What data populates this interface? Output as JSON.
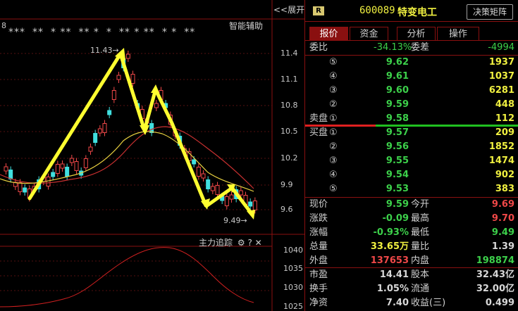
{
  "toolbar": {
    "expand_label": "<<展开",
    "badge": "R",
    "code": "600089",
    "name": "特变电工",
    "decision_button": "决策矩阵"
  },
  "chart": {
    "corner_label": "8",
    "stars": [
      "***",
      "**",
      "* **",
      "** *",
      "*",
      "** * **",
      "* *",
      "**"
    ],
    "assist_label": "智能辅助",
    "high_marker": "11.43",
    "low_marker": "9.49",
    "y_ticks": [
      "11.4",
      "11.1",
      "10.8",
      "10.5",
      "10.2",
      "9.9",
      "9.6"
    ],
    "sub_title": "主力追踪",
    "sub_y_ticks": [
      "1040",
      "1035",
      "1030",
      "1025"
    ]
  },
  "tabs": [
    "报价",
    "资金",
    "分析",
    "操作"
  ],
  "weibi": {
    "label1": "委比",
    "value1": "-34.13%",
    "label2": "委差",
    "value2": "-4994"
  },
  "sell": [
    {
      "label": "",
      "idx": "⑤",
      "price": "9.62",
      "vol": "1937"
    },
    {
      "label": "",
      "idx": "④",
      "price": "9.61",
      "vol": "1037"
    },
    {
      "label": "",
      "idx": "③",
      "price": "9.60",
      "vol": "6281"
    },
    {
      "label": "",
      "idx": "②",
      "price": "9.59",
      "vol": "448"
    },
    {
      "label": "卖盘",
      "idx": "①",
      "price": "9.58",
      "vol": "112"
    }
  ],
  "buy": [
    {
      "label": "买盘",
      "idx": "①",
      "price": "9.57",
      "vol": "209"
    },
    {
      "label": "",
      "idx": "②",
      "price": "9.56",
      "vol": "1852"
    },
    {
      "label": "",
      "idx": "③",
      "price": "9.55",
      "vol": "1474"
    },
    {
      "label": "",
      "idx": "④",
      "price": "9.54",
      "vol": "902"
    },
    {
      "label": "",
      "idx": "⑤",
      "price": "9.53",
      "vol": "383"
    }
  ],
  "quote": [
    {
      "l1": "现价",
      "v1": "9.59",
      "l2": "今开",
      "v2": "9.69"
    },
    {
      "l1": "涨跌",
      "v1": "-0.09",
      "l2": "最高",
      "v2": "9.70"
    },
    {
      "l1": "涨幅",
      "v1": "-0.93%",
      "l2": "最低",
      "v2": "9.49"
    },
    {
      "l1": "总量",
      "v1": "33.65万",
      "l2": "量比",
      "v2": "1.39"
    },
    {
      "l1": "外盘",
      "v1": "137653",
      "l2": "内盘",
      "v2": "198874"
    },
    {
      "l1": "市盈",
      "v1": "14.41",
      "l2": "股本",
      "v2": "32.43亿"
    },
    {
      "l1": "换手",
      "v1": "1.05%",
      "l2": "流通",
      "v2": "32.00亿"
    },
    {
      "l1": "净资",
      "v1": "7.40",
      "l2": "收益(三)",
      "v2": "0.499"
    }
  ],
  "colors": {
    "up": "#f04848",
    "down": "#3cd04a",
    "grid": "#8a1010",
    "yellow": "#f0f040",
    "cyan": "#40e0e0"
  }
}
